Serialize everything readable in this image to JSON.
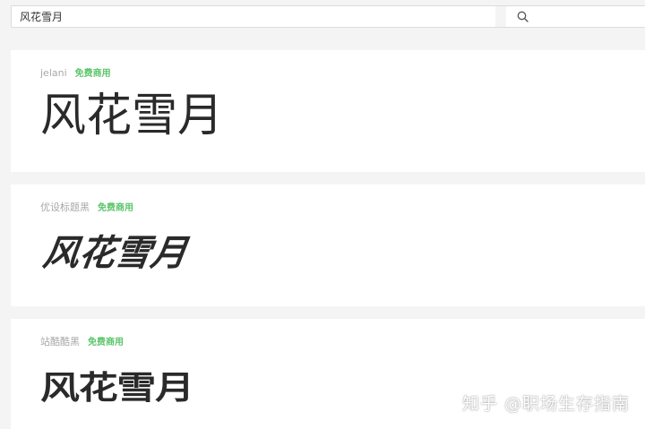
{
  "search": {
    "value": "风花雪月",
    "icon": "search-icon"
  },
  "results": [
    {
      "font_name": "jelani",
      "license": "免费商用",
      "sample": "风花雪月"
    },
    {
      "font_name": "优设标题黑",
      "license": "免费商用",
      "sample": "风花雪月"
    },
    {
      "font_name": "站酷酷黑",
      "license": "免费商用",
      "sample": "风花雪月"
    }
  ],
  "watermark": "知乎 @职场生存指南",
  "colors": {
    "license_green": "#5cc56b",
    "sample_text": "#2a2a2a",
    "meta_gray": "#a8a8a8",
    "page_bg": "#f4f4f4"
  }
}
